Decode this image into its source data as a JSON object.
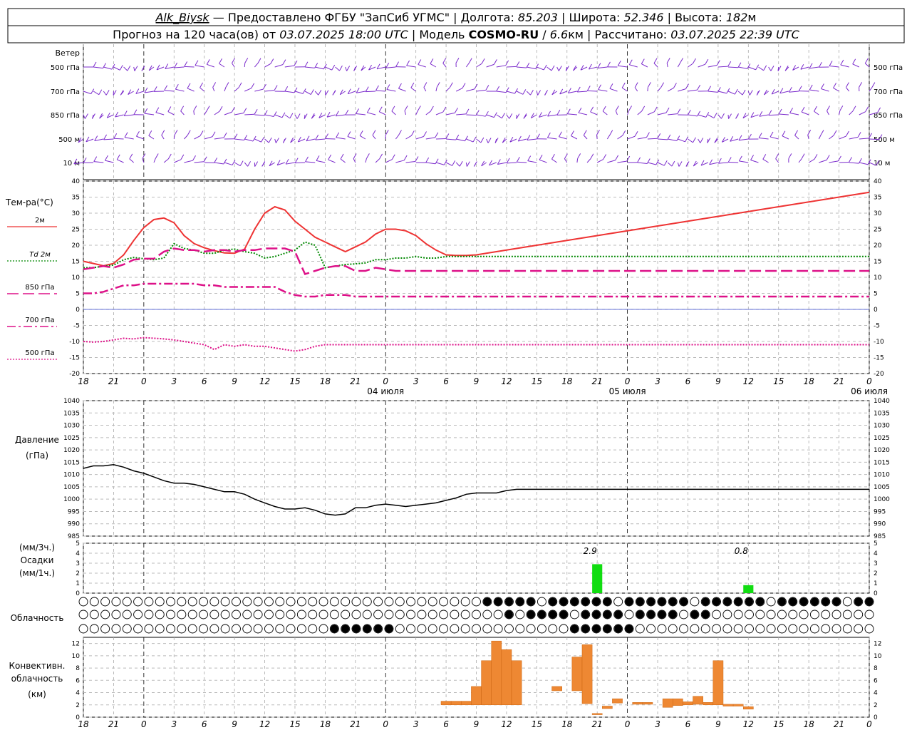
{
  "header": {
    "line1": [
      {
        "text": "Alk_Biysk",
        "italic": true,
        "underline": true
      },
      {
        "text": " — Предоставлено ФГБУ \"ЗапСиб УГМС\" | Долгота: "
      },
      {
        "text": "85.203",
        "italic": true
      },
      {
        "text": " | Широта: "
      },
      {
        "text": "52.346",
        "italic": true
      },
      {
        "text": " | Высота: "
      },
      {
        "text": "182",
        "italic": true
      },
      {
        "text": "м"
      }
    ],
    "line2": [
      {
        "text": "Прогноз на 120 часа(ов) от "
      },
      {
        "text": "03.07.2025 18:00 UTC",
        "italic": true
      },
      {
        "text": "  | Модель "
      },
      {
        "text": "COSMO-RU",
        "bold": true
      },
      {
        "text": " / "
      },
      {
        "text": "6.6",
        "italic": true
      },
      {
        "text": "км | Рассчитано: "
      },
      {
        "text": "03.07.2025 22:39 UTC",
        "italic": true
      }
    ]
  },
  "colors": {
    "t2m": "#ee3333",
    "td2m": "#008800",
    "t850": "#dd1188",
    "t700": "#dd1188",
    "t500": "#dd1188",
    "wind": "#7b2bcc",
    "precip": "#11dd11",
    "convective": "#ee8833",
    "grid": "#aaaaaa",
    "zero_line": "#3344cc"
  },
  "time_axis": {
    "tick_labels": [
      "18",
      "21",
      "0",
      "3",
      "6",
      "9",
      "12",
      "15",
      "18",
      "21",
      "0",
      "3",
      "6",
      "9",
      "12",
      "15",
      "18",
      "21",
      "0",
      "3",
      "6",
      "9",
      "12",
      "15",
      "18",
      "21",
      "0"
    ],
    "day_labels": [
      {
        "hour": 30,
        "label": "04 июля"
      },
      {
        "hour": 54,
        "label": "05 июля"
      },
      {
        "hour": 78,
        "label": "06 июля"
      }
    ]
  },
  "chart_data": [
    {
      "type": "wind-barbs",
      "label": "Ветер",
      "levels": [
        "500 гПа",
        "700 гПа",
        "850 гПа",
        "500 м",
        "10 м"
      ]
    },
    {
      "type": "line",
      "label": "Тем-ра(°С)",
      "ylim": [
        -20,
        40
      ],
      "yticks": [
        -20,
        -15,
        -10,
        -5,
        0,
        5,
        10,
        15,
        20,
        25,
        30,
        35,
        40
      ],
      "x_hours": [
        0,
        1,
        2,
        3,
        4,
        5,
        6,
        7,
        8,
        9,
        10,
        11,
        12,
        13,
        14,
        15,
        16,
        17,
        18,
        19,
        20,
        21,
        22,
        23,
        24,
        25,
        26,
        27,
        28,
        29,
        30,
        31,
        32,
        33,
        34,
        35,
        36,
        37,
        38,
        39,
        40,
        41,
        42,
        43,
        44,
        45,
        46,
        47,
        48,
        49,
        50,
        51,
        52,
        53,
        54,
        55,
        56,
        57,
        58,
        59,
        60,
        61,
        62,
        63,
        64,
        65,
        66,
        67,
        68,
        69,
        70,
        71,
        72,
        73,
        74,
        75,
        76,
        77,
        78
      ],
      "series": [
        {
          "name": "2м",
          "style": "solid",
          "values": [
            15.0,
            14.3,
            13.6,
            14.3,
            17.0,
            21.5,
            25.5,
            28.0,
            28.5,
            27.0,
            23.0,
            20.5,
            19.2,
            18.3,
            17.6,
            17.5,
            18.8,
            25.0,
            30.0,
            32.0,
            31.0,
            27.5,
            25.0,
            22.5,
            21.0,
            19.5,
            18.0,
            19.5,
            21.0,
            23.5,
            25.0,
            25.0,
            24.5,
            23.0,
            20.5,
            18.5,
            17.0,
            16.8,
            16.8,
            17.0,
            17.5,
            18.0,
            18.5,
            19.0,
            19.5,
            20.0,
            20.5,
            21.0,
            21.5,
            22.0,
            22.5,
            23.0,
            23.5,
            24.0,
            24.5,
            25.0,
            25.5,
            26.0,
            26.5,
            27.0,
            27.5,
            28.0,
            28.5,
            29.0,
            29.5,
            30.0,
            30.5,
            31.0,
            31.5,
            32.0,
            32.5,
            33.0,
            33.5,
            34.0,
            34.5,
            35.0,
            35.5,
            36.0,
            36.5
          ]
        },
        {
          "name": "Td 2м",
          "style": "dotted",
          "values": [
            13.0,
            13.0,
            13.5,
            13.8,
            15.5,
            16.2,
            15.8,
            15.5,
            16.0,
            20.5,
            19.0,
            18.5,
            17.5,
            17.5,
            18.5,
            18.8,
            18.0,
            17.5,
            16.0,
            16.5,
            17.5,
            18.5,
            21.0,
            20.0,
            13.0,
            13.5,
            14.0,
            14.2,
            14.5,
            15.5,
            15.5,
            16.0,
            16.0,
            16.5,
            16.0,
            16.0,
            16.5,
            16.5,
            16.5,
            16.5,
            16.5,
            16.5,
            16.5,
            16.5,
            16.5,
            16.5,
            16.5,
            16.5,
            16.5,
            16.5,
            16.5,
            16.5,
            16.5,
            16.5,
            16.5,
            16.5,
            16.5,
            16.5,
            16.5,
            16.5,
            16.5,
            16.5,
            16.5,
            16.5,
            16.5,
            16.5,
            16.5,
            16.5,
            16.5,
            16.5,
            16.5,
            16.5,
            16.5,
            16.5,
            16.5,
            16.5,
            16.5,
            16.5,
            16.5
          ]
        },
        {
          "name": "850 гПа",
          "style": "long-dash",
          "values": [
            12.5,
            13.0,
            13.5,
            13.0,
            14.0,
            15.5,
            15.8,
            15.8,
            18.0,
            19.0,
            18.5,
            18.5,
            18.0,
            18.5,
            18.5,
            18.0,
            18.5,
            18.5,
            19.0,
            19.0,
            19.0,
            18.0,
            11.0,
            12.0,
            13.0,
            13.5,
            13.5,
            12.0,
            12.0,
            13.0,
            12.5,
            12.0,
            12.0,
            12.0,
            12.0,
            12.0,
            12.0,
            12.0,
            12.0,
            12.0,
            12.0,
            12.0,
            12.0,
            12.0,
            12.0,
            12.0,
            12.0,
            12.0,
            12.0,
            12.0,
            12.0,
            12.0,
            12.0,
            12.0,
            12.0,
            12.0,
            12.0,
            12.0,
            12.0,
            12.0,
            12.0,
            12.0,
            12.0,
            12.0,
            12.0,
            12.0,
            12.0,
            12.0,
            12.0,
            12.0,
            12.0,
            12.0,
            12.0,
            12.0,
            12.0,
            12.0,
            12.0,
            12.0,
            12.0
          ]
        },
        {
          "name": "700 гПа",
          "style": "dash-dot",
          "values": [
            5.0,
            5.0,
            5.5,
            6.5,
            7.5,
            7.5,
            8.0,
            8.0,
            8.0,
            8.0,
            8.0,
            8.0,
            7.5,
            7.5,
            7.0,
            7.0,
            7.0,
            7.0,
            7.0,
            7.0,
            5.5,
            4.5,
            4.0,
            4.0,
            4.5,
            4.5,
            4.5,
            4.0,
            4.0,
            4.0,
            4.0,
            4.0,
            4.0,
            4.0,
            4.0,
            4.0,
            4.0,
            4.0,
            4.0,
            4.0,
            4.0,
            4.0,
            4.0,
            4.0,
            4.0,
            4.0,
            4.0,
            4.0,
            4.0,
            4.0,
            4.0,
            4.0,
            4.0,
            4.0,
            4.0,
            4.0,
            4.0,
            4.0,
            4.0,
            4.0,
            4.0,
            4.0,
            4.0,
            4.0,
            4.0,
            4.0,
            4.0,
            4.0,
            4.0,
            4.0,
            4.0,
            4.0,
            4.0,
            4.0,
            4.0,
            4.0,
            4.0,
            4.0,
            4.0
          ]
        },
        {
          "name": "500 гПа",
          "style": "dotted",
          "values": [
            -10.0,
            -10.2,
            -10.0,
            -9.5,
            -9.0,
            -9.2,
            -8.8,
            -9.0,
            -9.2,
            -9.5,
            -10.0,
            -10.5,
            -11.0,
            -12.5,
            -11.0,
            -11.5,
            -11.0,
            -11.5,
            -11.5,
            -12.0,
            -12.5,
            -13.0,
            -12.5,
            -11.5,
            -11.0,
            -11.0,
            -11.0,
            -11.0,
            -11.0,
            -11.0,
            -11.0,
            -11.0,
            -11.0,
            -11.0,
            -11.0,
            -11.0,
            -11.0,
            -11.0,
            -11.0,
            -11.0,
            -11.0,
            -11.0,
            -11.0,
            -11.0,
            -11.0,
            -11.0,
            -11.0,
            -11.0,
            -11.0,
            -11.0,
            -11.0,
            -11.0,
            -11.0,
            -11.0,
            -11.0,
            -11.0,
            -11.0,
            -11.0,
            -11.0,
            -11.0,
            -11.0,
            -11.0,
            -11.0,
            -11.0,
            -11.0,
            -11.0,
            -11.0,
            -11.0,
            -11.0,
            -11.0,
            -11.0,
            -11.0,
            -11.0,
            -11.0,
            -11.0,
            -11.0,
            -11.0,
            -11.0,
            -11.0
          ]
        }
      ]
    },
    {
      "type": "line",
      "label": "Давление",
      "unit_label": "(гПа)",
      "ylim": [
        985,
        1040
      ],
      "yticks": [
        985,
        990,
        995,
        1000,
        1005,
        1010,
        1015,
        1020,
        1025,
        1030,
        1035,
        1040
      ],
      "x_hours": [
        0,
        1,
        2,
        3,
        4,
        5,
        6,
        7,
        8,
        9,
        10,
        11,
        12,
        13,
        14,
        15,
        16,
        17,
        18,
        19,
        20,
        21,
        22,
        23,
        24,
        25,
        26,
        27,
        28,
        29,
        30,
        31,
        32,
        33,
        34,
        35,
        36,
        37,
        38,
        39,
        40,
        41,
        42,
        43,
        44,
        45,
        46,
        47,
        48,
        49,
        50,
        51,
        52,
        53,
        54,
        55,
        56,
        57,
        58,
        59,
        60,
        61,
        62,
        63,
        64,
        65,
        66,
        67,
        68,
        69,
        70,
        71,
        72,
        73,
        74,
        75,
        76,
        77,
        78
      ],
      "values": [
        1012.5,
        1013.5,
        1013.5,
        1014,
        1013,
        1011.5,
        1010.5,
        1009,
        1007.5,
        1006.5,
        1006.5,
        1006,
        1005,
        1004,
        1003,
        1003,
        1002,
        1000,
        998.5,
        997,
        996,
        996,
        996.5,
        995.5,
        994,
        993.5,
        994,
        996.5,
        996.5,
        997.5,
        998,
        997.5,
        997,
        997.5,
        998,
        998.5,
        999.5,
        1000.5,
        1002,
        1002.5,
        1002.5,
        1002.5,
        1003.5,
        1004,
        1004,
        1004,
        1004,
        1004,
        1004,
        1004,
        1004,
        1004,
        1004,
        1004,
        1004,
        1004,
        1004,
        1004,
        1004,
        1004,
        1004,
        1004,
        1004,
        1004,
        1004,
        1004,
        1004,
        1004,
        1004,
        1004,
        1004,
        1004,
        1004,
        1004,
        1004,
        1004,
        1004,
        1004,
        1004,
        1004
      ]
    },
    {
      "type": "bar",
      "label": "Осадки",
      "unit_labels": [
        "(мм/3ч.)",
        "(мм/1ч.)"
      ],
      "ylim": [
        0,
        5
      ],
      "yticks": [
        0,
        1,
        2,
        3,
        4,
        5
      ],
      "bars": [
        {
          "hour": 51,
          "value": 2.9,
          "label": "2.9"
        },
        {
          "hour": 66,
          "value": 0.8,
          "label": "0.8"
        }
      ]
    },
    {
      "type": "cloud-symbols",
      "label": "Облачность",
      "layers": [
        "upper",
        "middle",
        "lower"
      ]
    },
    {
      "type": "bar",
      "label": "Конвективн. облачность",
      "unit_label": "(км)",
      "ylim": [
        0,
        13
      ],
      "yticks": [
        0,
        2,
        4,
        6,
        8,
        10,
        12
      ],
      "cells": [
        {
          "hour": 36,
          "base": 2.0,
          "top": 2.6
        },
        {
          "hour": 37,
          "base": 2.0,
          "top": 2.6
        },
        {
          "hour": 38,
          "base": 2.0,
          "top": 2.6
        },
        {
          "hour": 39,
          "base": 2.0,
          "top": 5.0
        },
        {
          "hour": 40,
          "base": 2.0,
          "top": 9.2
        },
        {
          "hour": 41,
          "base": 2.0,
          "top": 12.4
        },
        {
          "hour": 42,
          "base": 2.0,
          "top": 11.0
        },
        {
          "hour": 43,
          "base": 2.0,
          "top": 9.2
        },
        {
          "hour": 47,
          "base": 4.3,
          "top": 5.0
        },
        {
          "hour": 49,
          "base": 4.3,
          "top": 9.8
        },
        {
          "hour": 50,
          "base": 2.2,
          "top": 11.8
        },
        {
          "hour": 51,
          "base": 0.4,
          "top": 0.6
        },
        {
          "hour": 52,
          "base": 1.4,
          "top": 1.8
        },
        {
          "hour": 53,
          "base": 2.3,
          "top": 3.0
        },
        {
          "hour": 55,
          "base": 2.1,
          "top": 2.4
        },
        {
          "hour": 56,
          "base": 2.1,
          "top": 2.4
        },
        {
          "hour": 58,
          "base": 1.6,
          "top": 3.0
        },
        {
          "hour": 59,
          "base": 1.9,
          "top": 3.0
        },
        {
          "hour": 60,
          "base": 2.0,
          "top": 2.5
        },
        {
          "hour": 61,
          "base": 2.1,
          "top": 3.4
        },
        {
          "hour": 62,
          "base": 2.0,
          "top": 2.4
        },
        {
          "hour": 63,
          "base": 2.0,
          "top": 9.2
        },
        {
          "hour": 64,
          "base": 1.8,
          "top": 2.1
        },
        {
          "hour": 65,
          "base": 1.8,
          "top": 2.1
        },
        {
          "hour": 66,
          "base": 1.3,
          "top": 1.7
        }
      ]
    }
  ]
}
